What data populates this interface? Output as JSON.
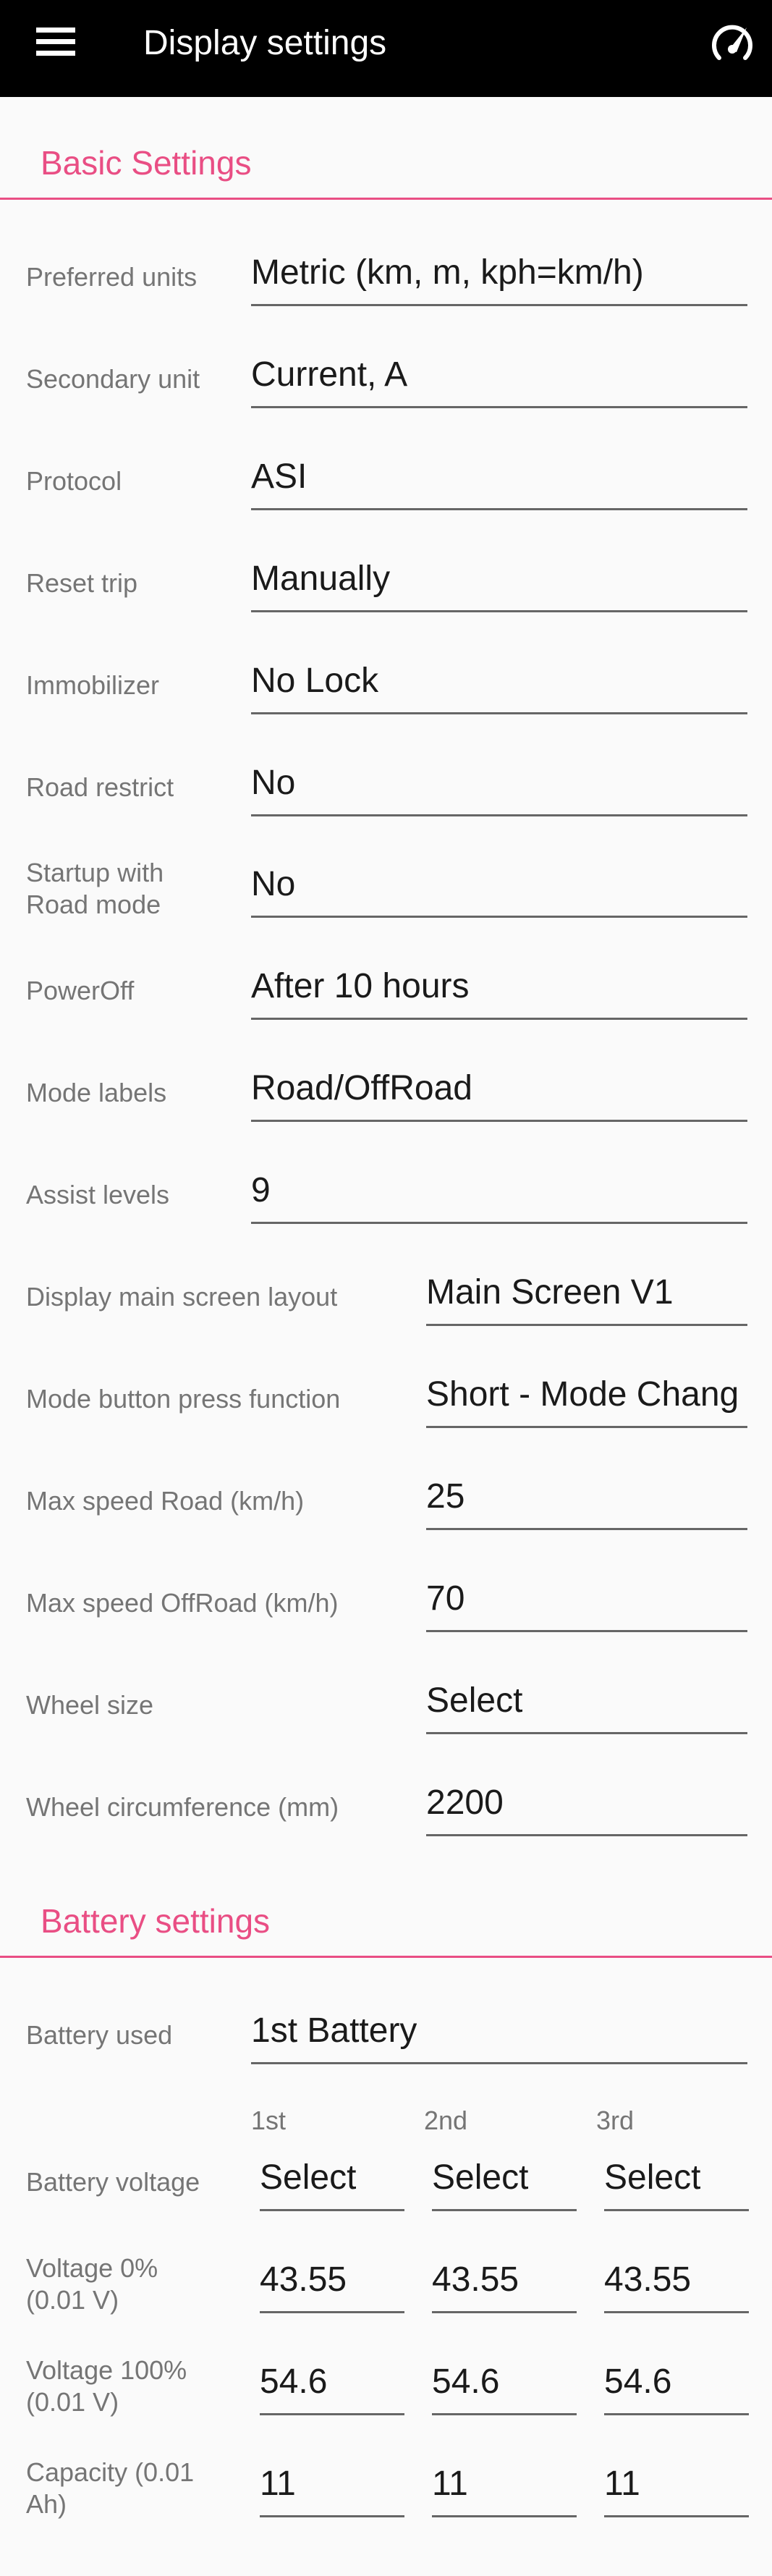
{
  "appbar": {
    "title": "Display settings",
    "menu_icon": "hamburger-menu-icon",
    "right_icon": "speedometer-icon"
  },
  "colors": {
    "appbar_bg": "#000000",
    "accent": "#e94e84",
    "label": "#757575",
    "value": "#1a1a1a",
    "background": "#fafafa"
  },
  "basic": {
    "title": "Basic Settings",
    "rows": [
      {
        "label": "Preferred units",
        "value": "Metric (km, m, kph=km/h)"
      },
      {
        "label": "Secondary unit",
        "value": "Current, A"
      },
      {
        "label": "Protocol",
        "value": "ASI"
      },
      {
        "label": "Reset trip",
        "value": "Manually"
      },
      {
        "label": "Immobilizer",
        "value": "No Lock"
      },
      {
        "label": "Road restrict",
        "value": "No"
      },
      {
        "label": "Startup with Road mode",
        "value": "No"
      },
      {
        "label": "PowerOff",
        "value": "After 10 hours"
      },
      {
        "label": "Mode labels",
        "value": "Road/OffRoad"
      },
      {
        "label": "Assist levels",
        "value": "9"
      },
      {
        "label": "Display main screen layout",
        "value": "Main Screen V1"
      },
      {
        "label": "Mode button press function",
        "value": "Short - Mode Chang"
      },
      {
        "label": "Max speed Road (km/h)",
        "value": "25"
      },
      {
        "label": "Max speed OffRoad (km/h)",
        "value": "70"
      },
      {
        "label": "Wheel size",
        "value": "Select"
      },
      {
        "label": "Wheel circumference (mm)",
        "value": "2200"
      }
    ]
  },
  "battery": {
    "title": "Battery settings",
    "used": {
      "label": "Battery used",
      "value": "1st Battery"
    },
    "columns": [
      "1st",
      "2nd",
      "3rd"
    ],
    "rows": [
      {
        "label": "Battery voltage",
        "values": [
          "Select",
          "Select",
          "Select"
        ]
      },
      {
        "label": "Voltage 0% (0.01 V)",
        "values": [
          "43.55",
          "43.55",
          "43.55"
        ]
      },
      {
        "label": "Voltage 100% (0.01 V)",
        "values": [
          "54.6",
          "54.6",
          "54.6"
        ]
      },
      {
        "label": "Capacity (0.01 Ah)",
        "values": [
          "11",
          "11",
          "11"
        ]
      }
    ]
  }
}
